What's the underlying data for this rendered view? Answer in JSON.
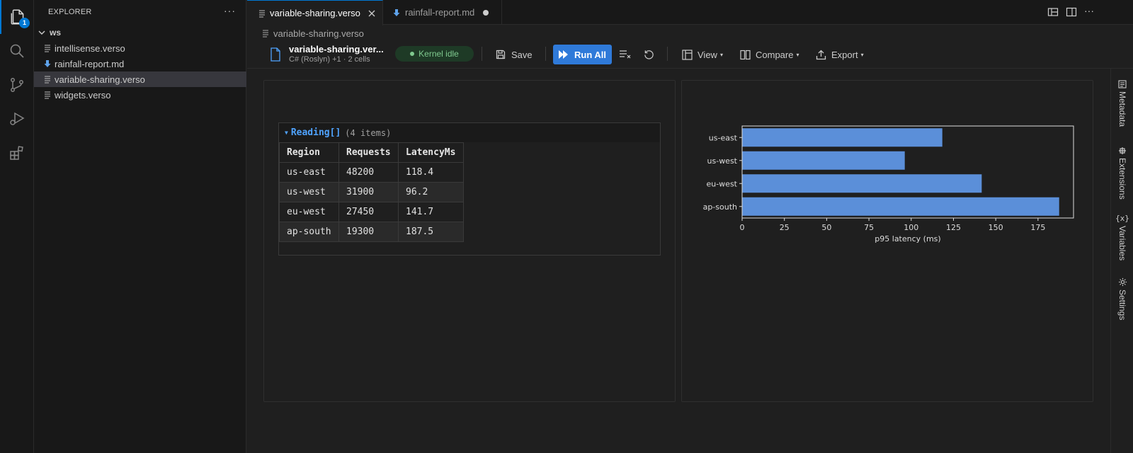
{
  "activity_bar": {
    "badge": "1",
    "items": [
      "explorer-icon",
      "search-icon",
      "source-control-icon",
      "run-debug-icon",
      "extensions-icon"
    ]
  },
  "explorer": {
    "title": "EXPLORER",
    "more": "···",
    "workspace": "ws",
    "files": [
      {
        "name": "intellisense.verso",
        "icon": "verso-file-icon"
      },
      {
        "name": "rainfall-report.md",
        "icon": "markdown-file-icon"
      },
      {
        "name": "variable-sharing.verso",
        "icon": "verso-file-icon",
        "selected": true
      },
      {
        "name": "widgets.verso",
        "icon": "verso-file-icon"
      }
    ]
  },
  "tabs": [
    {
      "label": "variable-sharing.verso",
      "active": true
    },
    {
      "label": "rainfall-report.md",
      "active": false,
      "dirty": true
    }
  ],
  "breadcrumb": "variable-sharing.verso",
  "toolbar": {
    "doc_title": "variable-sharing.ver...",
    "doc_subtitle": "C# (Roslyn) +1 · 2 cells",
    "kernel_status": "Kernel idle",
    "save": "Save",
    "run_all": "Run All",
    "view": "View",
    "compare": "Compare",
    "export": "Export"
  },
  "output_table": {
    "type_name": "Reading[]",
    "count": "(4 items)",
    "columns": [
      "Region",
      "Requests",
      "LatencyMs"
    ],
    "rows": [
      [
        "us-east",
        "48200",
        "118.4"
      ],
      [
        "us-west",
        "31900",
        "96.2"
      ],
      [
        "eu-west",
        "27450",
        "141.7"
      ],
      [
        "ap-south",
        "19300",
        "187.5"
      ]
    ]
  },
  "chart_data": {
    "type": "bar",
    "orientation": "horizontal",
    "categories": [
      "us-east",
      "us-west",
      "eu-west",
      "ap-south"
    ],
    "values": [
      118.4,
      96.2,
      141.7,
      187.5
    ],
    "xlabel": "p95 latency (ms)",
    "xlim": [
      0,
      196
    ],
    "xticks": [
      0,
      25,
      50,
      75,
      100,
      125,
      150,
      175
    ],
    "bar_color": "#5b8fd9"
  },
  "right_rail": [
    "Metadata",
    "Extensions",
    "Variables",
    "Settings"
  ],
  "colors": {
    "accent": "#0078d4",
    "run_all": "#2f7ad9",
    "kernel_ok": "#7fc98f"
  }
}
